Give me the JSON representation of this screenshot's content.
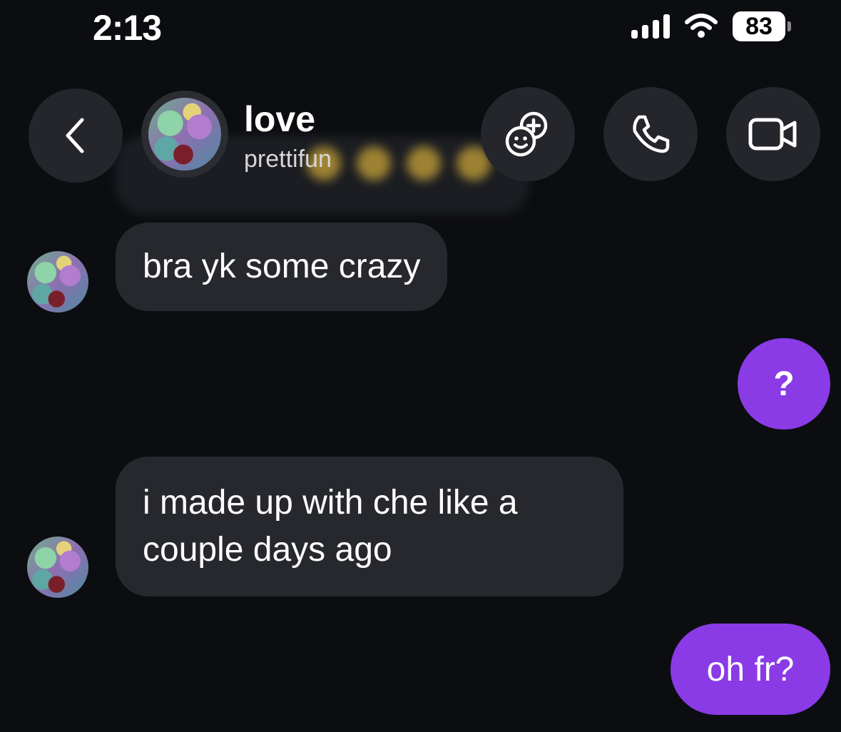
{
  "status_bar": {
    "time": "2:13",
    "battery": "83",
    "icons": [
      "signal-icon",
      "wifi-icon",
      "battery-icon"
    ]
  },
  "header": {
    "contact_name": "love",
    "username": "prettifun",
    "icons": [
      "back-chevron-icon",
      "add-effect-icon",
      "phone-icon",
      "video-camera-icon"
    ]
  },
  "messages": [
    {
      "sender": "them",
      "text": "bra yk some crazy"
    },
    {
      "sender": "me",
      "text": "?"
    },
    {
      "sender": "them",
      "lines": [
        "i made up with che like a",
        "couple days ago"
      ]
    },
    {
      "sender": "me",
      "text": "oh fr?"
    }
  ],
  "colors": {
    "background": "#0c0d11",
    "incoming_bubble": "#26282d",
    "outgoing_bubble": "#8a3be6",
    "header_button": "#24262b"
  }
}
